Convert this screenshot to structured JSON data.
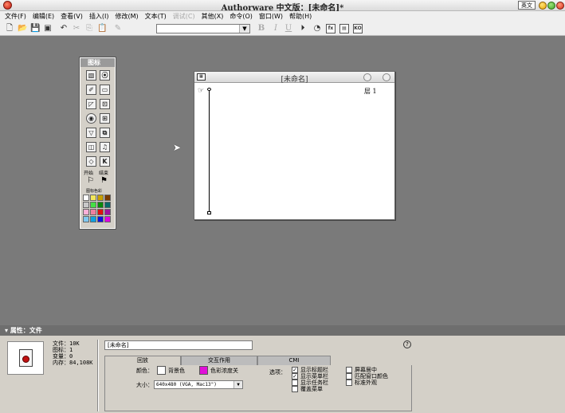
{
  "app": {
    "title": "Authorware 中文版：[未命名]*",
    "ime_label": "英文"
  },
  "menu": [
    "文件(F)",
    "编辑(E)",
    "查看(V)",
    "插入(I)",
    "修改(M)",
    "文本(T)",
    "调试(C)",
    "其他(X)",
    "命令(O)",
    "窗口(W)",
    "帮助(H)"
  ],
  "menu_disabled": [
    false,
    false,
    false,
    false,
    false,
    false,
    true,
    false,
    false,
    false,
    false
  ],
  "toolbar": {
    "icons": [
      "new-icon",
      "open-icon",
      "save-all-icon",
      "import-icon",
      "undo-icon",
      "cut-icon",
      "copy-icon",
      "paste-icon",
      "find-icon",
      "bold-icon",
      "italic-icon",
      "underline-icon",
      "run-icon",
      "control-panel-icon",
      "functions-icon",
      "variables-icon",
      "knowledge-objects-icon"
    ],
    "bold": "B",
    "italic": "I",
    "underline": "U",
    "font_value": ""
  },
  "palette": {
    "title": "图标",
    "start_label": "开始",
    "end_label": "结束",
    "color_label": "图标色彩",
    "colors": [
      "#ffffff",
      "#f2e65a",
      "#c8a000",
      "#7a3a00",
      "#c8c8c8",
      "#44e044",
      "#0a8a0a",
      "#0a6a6a",
      "#ffb0d8",
      "#f080a0",
      "#e01010",
      "#a010a0",
      "#80c8f0",
      "#10a0e0",
      "#1010e0",
      "#e000e0"
    ]
  },
  "flow_window": {
    "title": "[未命名]",
    "layer_label": "层 1"
  },
  "properties": {
    "bar_title": "属性：文件",
    "stats": [
      "文件：10K",
      "图标：1",
      "变量：0",
      "内存：84,108K"
    ],
    "file_name": "[未命名]",
    "help": "?",
    "tabs": [
      "回放",
      "交互作用",
      "CMI"
    ],
    "color_label": "颜色：",
    "bg_color_label": "背景色",
    "chroma_label": "色彩浓度关",
    "size_label": "大小：",
    "size_value": "640x480 (VGA, Mac13\")",
    "options_label": "选项：",
    "options_col1": [
      {
        "label": "显示标题栏",
        "checked": true
      },
      {
        "label": "显示菜单栏",
        "checked": true
      },
      {
        "label": "显示任务栏",
        "checked": false
      },
      {
        "label": "覆盖菜单",
        "checked": false
      }
    ],
    "options_col2": [
      {
        "label": "屏幕居中",
        "checked": false
      },
      {
        "label": "匹配窗口颜色",
        "checked": false
      },
      {
        "label": "标准外观",
        "checked": false
      }
    ]
  }
}
